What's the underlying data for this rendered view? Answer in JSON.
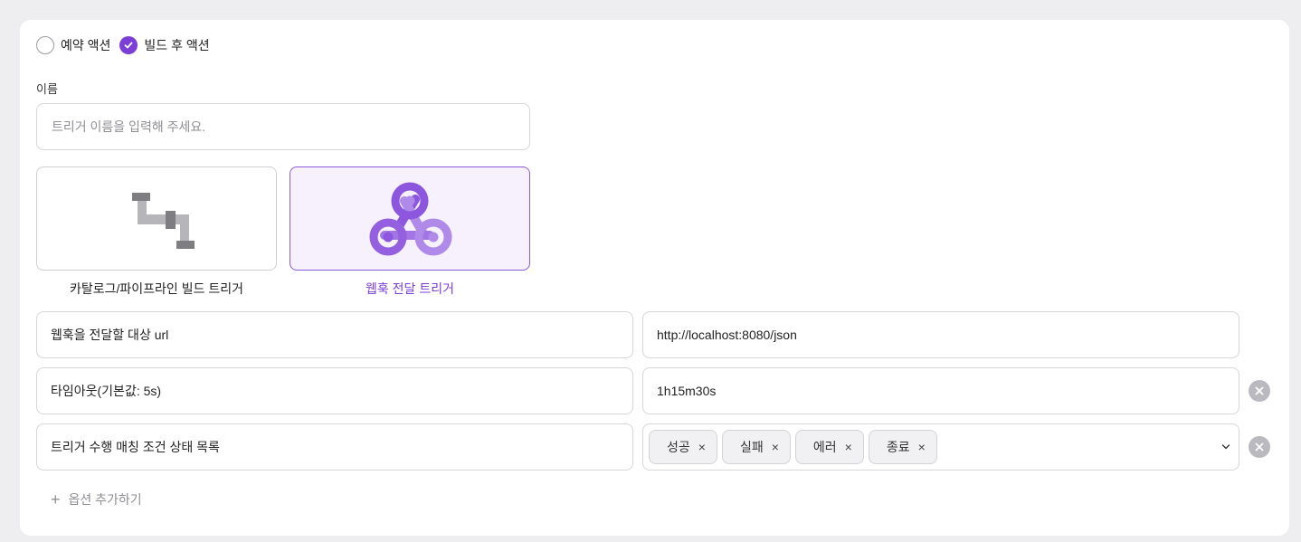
{
  "trigger_type": {
    "options": [
      "예약 액션",
      "빌드 후 액션"
    ],
    "selected": "빌드 후 액션"
  },
  "name": {
    "label": "이름",
    "placeholder": "트리거 이름을 입력해 주세요.",
    "value": ""
  },
  "kinds": [
    {
      "label": "카탈로그/파이프라인 빌드 트리거",
      "icon": "pipe-icon",
      "selected": false
    },
    {
      "label": "웹훅 전달 트리거",
      "icon": "webhook-icon",
      "selected": true
    }
  ],
  "options": [
    {
      "key": "웹훅을 전달할 대상 url",
      "value": "http://localhost:8080/json",
      "removable": false
    },
    {
      "key": "타임아웃(기본값: 5s)",
      "value": "1h15m30s",
      "removable": true
    },
    {
      "key": "트리거 수행 매칭 조건 상태 목록",
      "tags": [
        "성공",
        "실패",
        "에러",
        "종료"
      ],
      "removable": true
    }
  ],
  "add_option_label": "옵션 추가하기",
  "colors": {
    "accent": "#7b3fd6",
    "accent_bg": "#f6f1fd",
    "border": "#d6d6db",
    "muted": "#8e8e95"
  }
}
